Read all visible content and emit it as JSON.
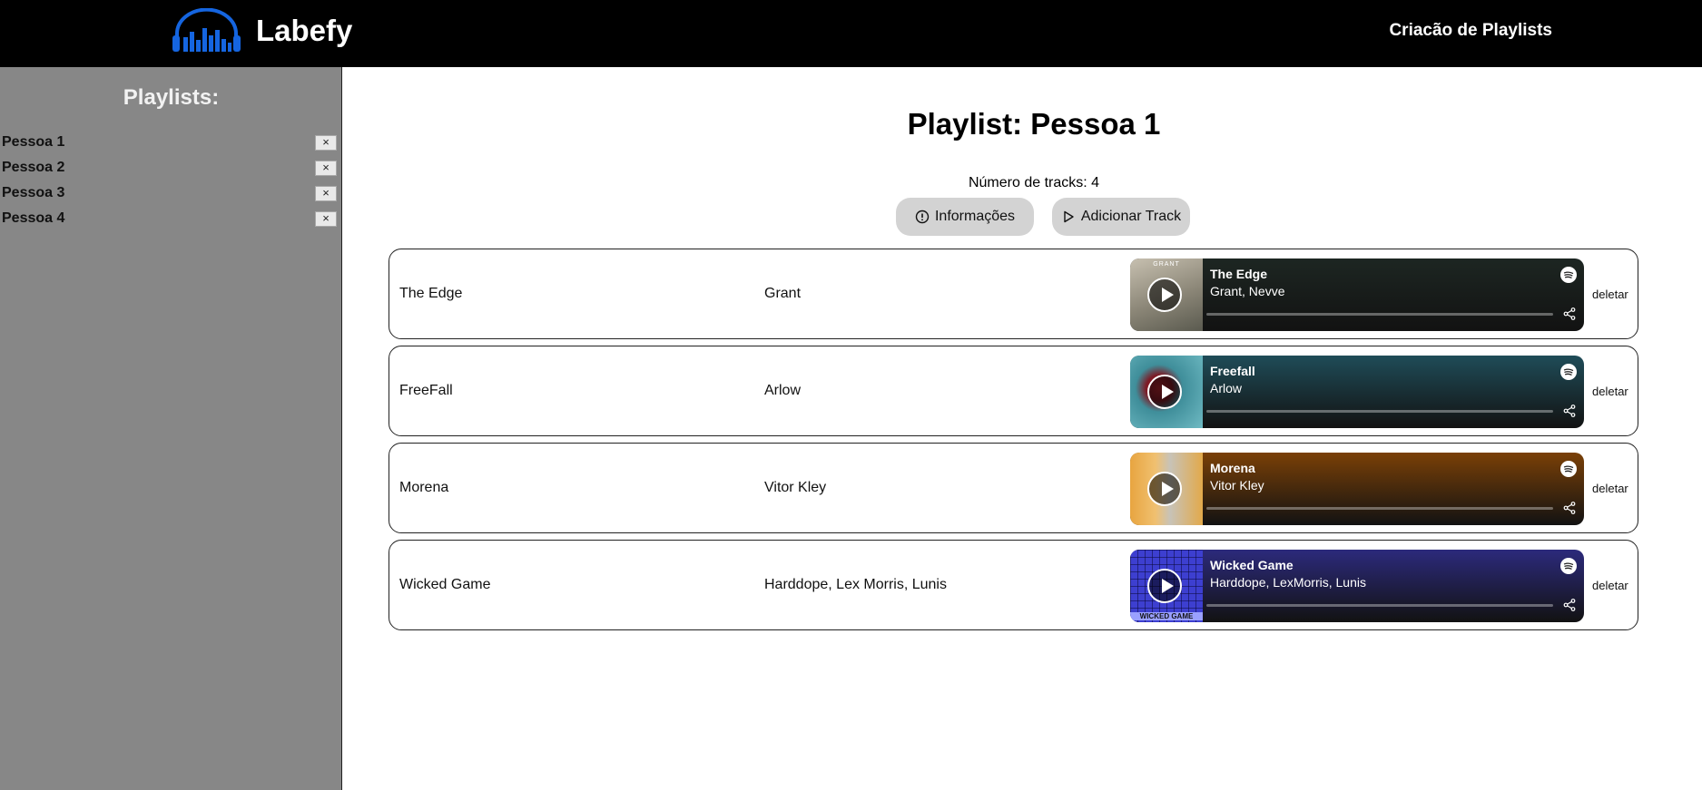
{
  "app": {
    "name": "Labefy",
    "nav_link": "Criacão de Playlists"
  },
  "sidebar": {
    "title": "Playlists:",
    "items": [
      {
        "label": "Pessoa 1",
        "delete": "×"
      },
      {
        "label": "Pessoa 2",
        "delete": "×"
      },
      {
        "label": "Pessoa 3",
        "delete": "×"
      },
      {
        "label": "Pessoa 4",
        "delete": "×"
      }
    ]
  },
  "main": {
    "title": "Playlist: Pessoa 1",
    "track_count": "Número de tracks: 4",
    "info_button": "Informações",
    "add_button": "Adicionar Track",
    "delete_label": "deletar",
    "tracks": [
      {
        "name": "The Edge",
        "artist": "Grant",
        "embed_title": "The Edge",
        "embed_artist": "Grant, Nevve",
        "cover_text": "GRANT",
        "bg": "#1d2622"
      },
      {
        "name": "FreeFall",
        "artist": "Arlow",
        "embed_title": "Freefall",
        "embed_artist": "Arlow",
        "cover_text": "",
        "bg": "#1f4c58"
      },
      {
        "name": "Morena",
        "artist": "Vitor Kley",
        "embed_title": "Morena",
        "embed_artist": "Vitor Kley",
        "cover_text": "",
        "bg": "#7a4007"
      },
      {
        "name": "Wicked Game",
        "artist": "Harddope, Lex Morris, Lunis",
        "embed_title": "Wicked Game",
        "embed_artist": "Harddope, LexMorris, Lunis",
        "cover_text": "WICKED GAME",
        "bg": "#2c2a7c"
      }
    ]
  },
  "colors": {
    "topbar": "#000000",
    "sidebar": "#878787",
    "logo": "#1565e0",
    "button": "#d3d3d3"
  }
}
